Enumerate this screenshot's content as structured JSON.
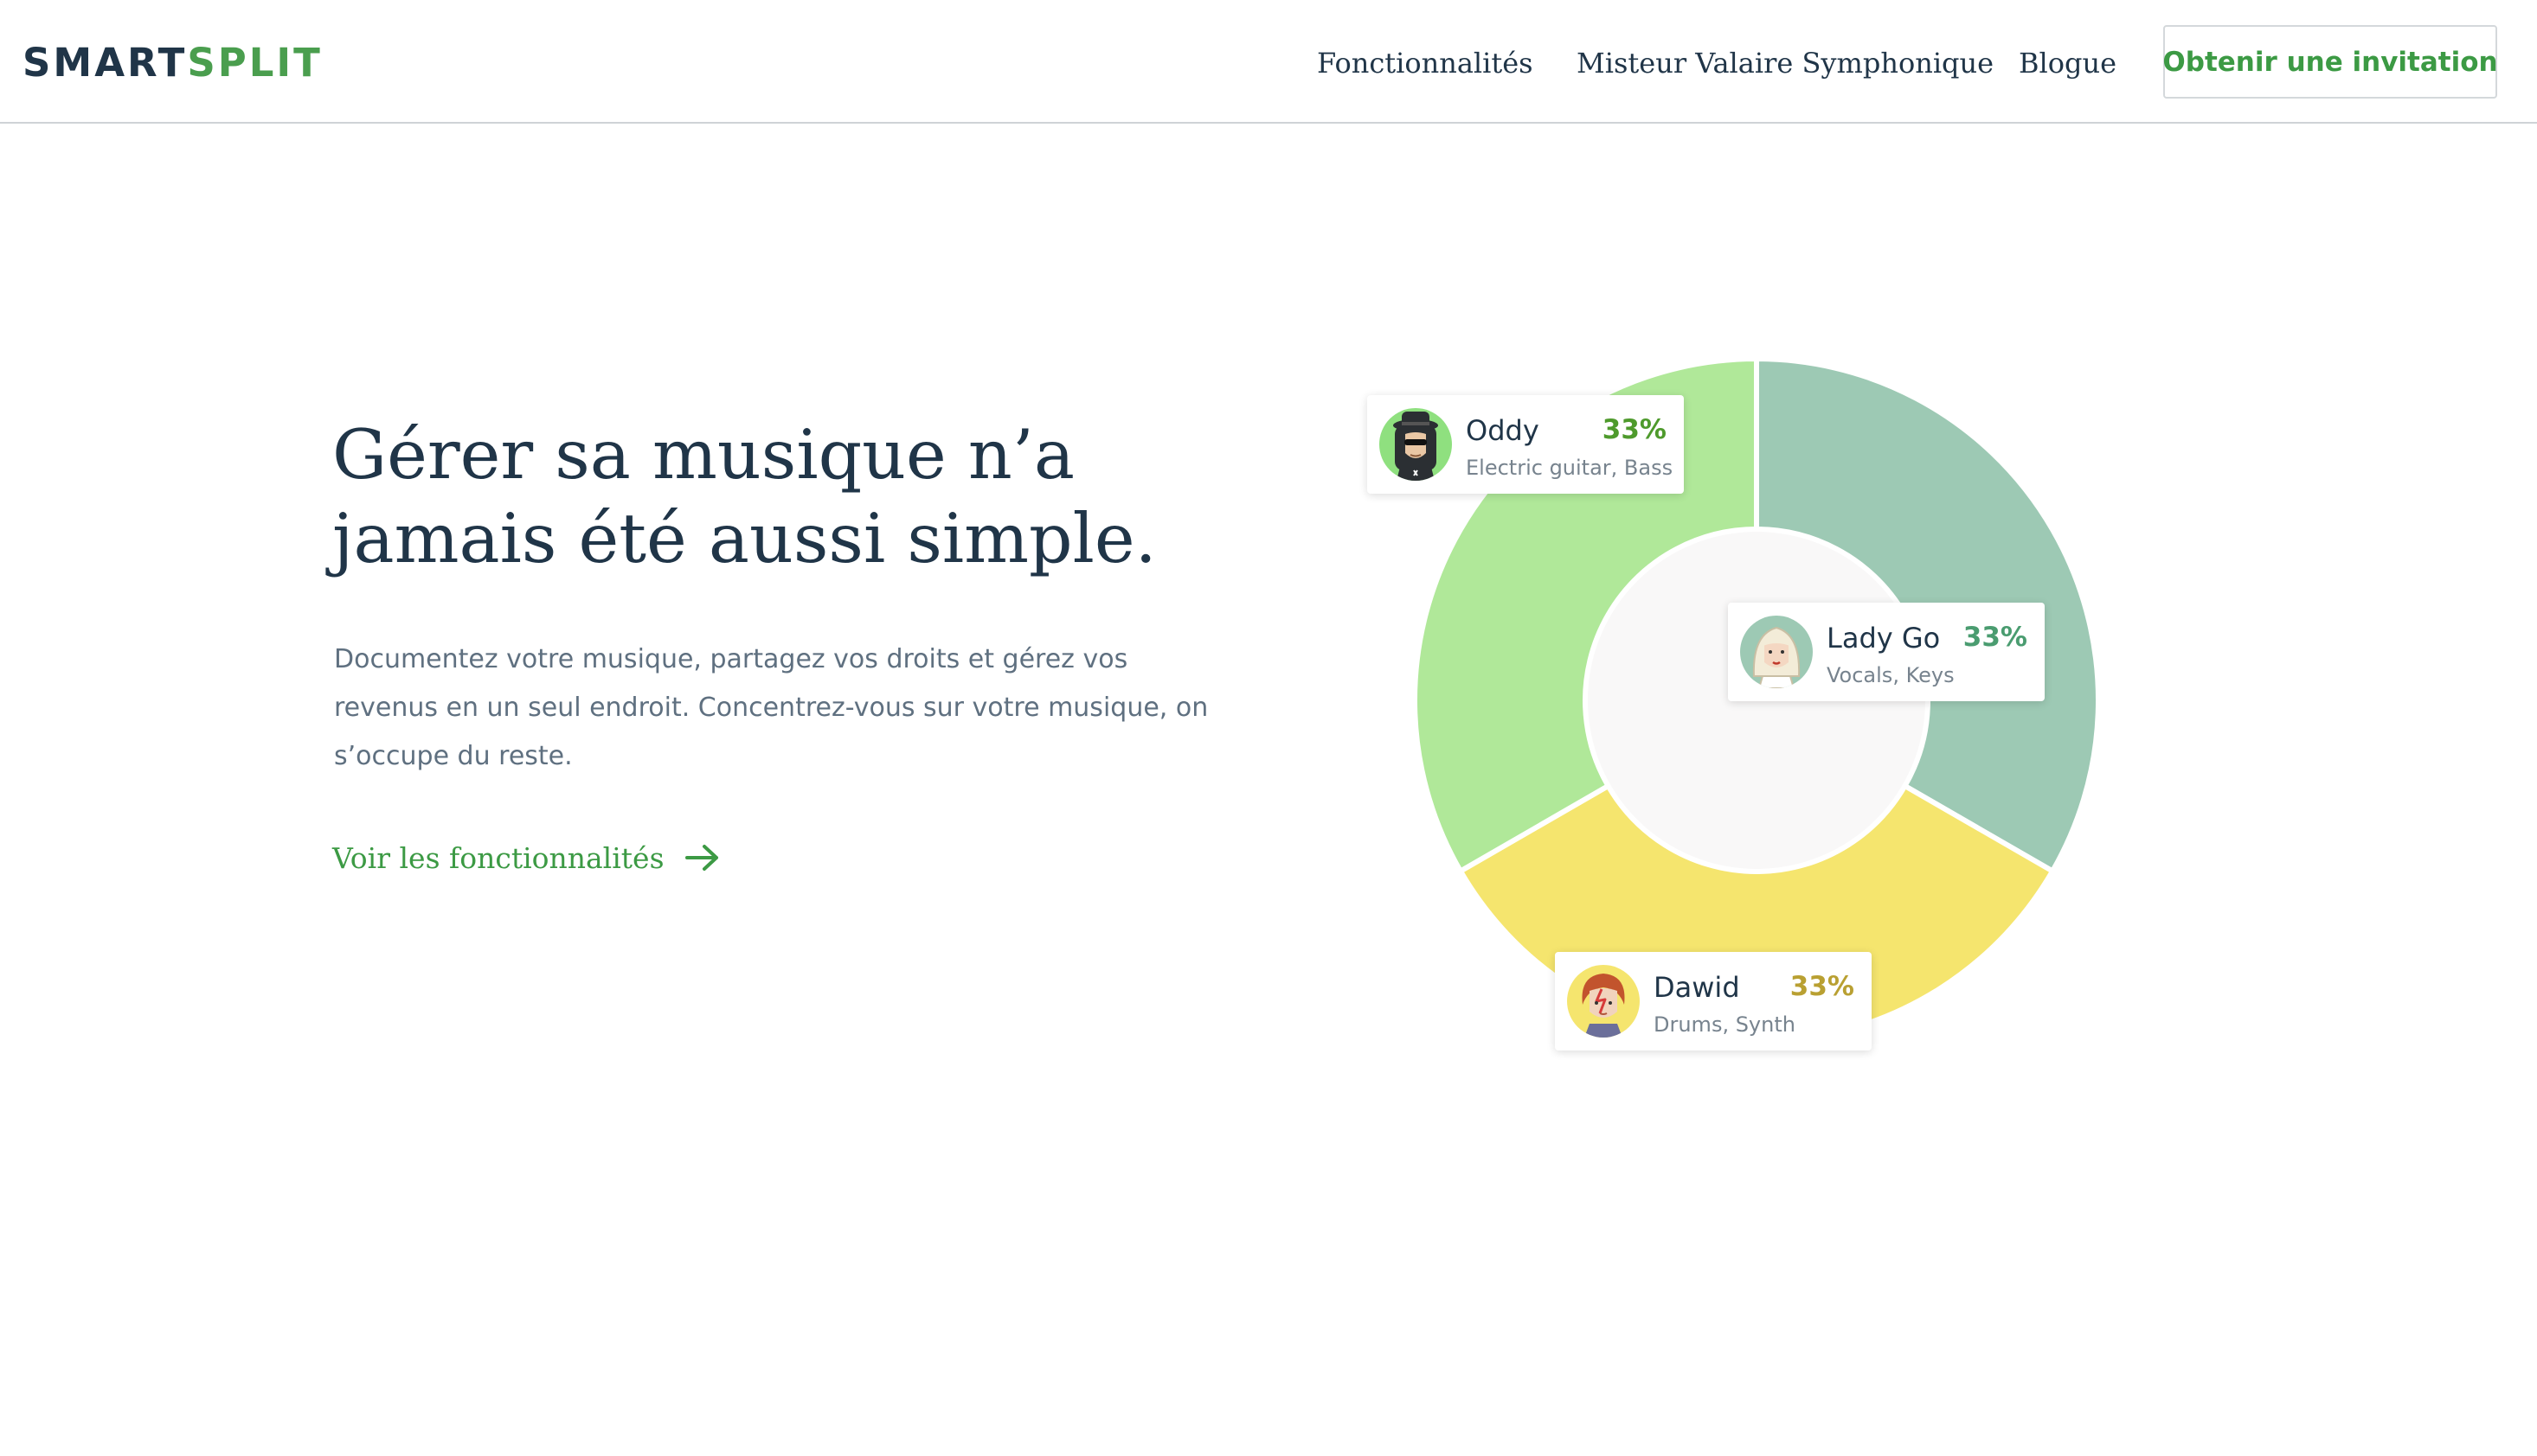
{
  "header": {
    "logo": {
      "part1": "SMART",
      "part2": "SPLIT"
    },
    "nav": {
      "features": "Fonctionnalités",
      "valaire": "Misteur Valaire Symphonique",
      "blog": "Blogue"
    },
    "cta": "Obtenir une invitation"
  },
  "hero": {
    "title_line1": "Gérer sa musique n’a",
    "title_line2": "jamais été aussi simple.",
    "description": "Documentez votre musique, partagez vos droits et gérez vos revenus en un seul endroit. Concentrez-vous sur votre musique, on s’occupe du reste.",
    "cta": "Voir les fonctionnalités",
    "cta_icon": "arrow-right-icon"
  },
  "chart_data": {
    "type": "pie",
    "variant": "donut",
    "categories": [
      "Lady Go",
      "Dawid",
      "Oddy"
    ],
    "values": [
      33,
      33,
      33
    ],
    "colors": [
      "#9dc9b4",
      "#f5e56e",
      "#b0e899"
    ],
    "hole_color": "#f9f8f8"
  },
  "collaborators": [
    {
      "id": "oddy",
      "name": "Oddy",
      "percent": "33%",
      "roles": "Electric guitar, Bass",
      "accent": "#4e9a2c",
      "avatar_bg": "#8fe07f",
      "avatar_icon": "rocker-avatar-icon"
    },
    {
      "id": "lady",
      "name": "Lady Go",
      "percent": "33%",
      "roles": "Vocals, Keys",
      "accent": "#4a9c70",
      "avatar_bg": "#9dc9b4",
      "avatar_icon": "singer-avatar-icon"
    },
    {
      "id": "dawid",
      "name": "Dawid",
      "percent": "33%",
      "roles": "Drums, Synth",
      "accent": "#b9a032",
      "avatar_bg": "#f5e56e",
      "avatar_icon": "glam-avatar-icon"
    }
  ],
  "colors": {
    "brand_dark": "#203548",
    "brand_green": "#4a9e4e",
    "text_muted": "#5f7080"
  }
}
